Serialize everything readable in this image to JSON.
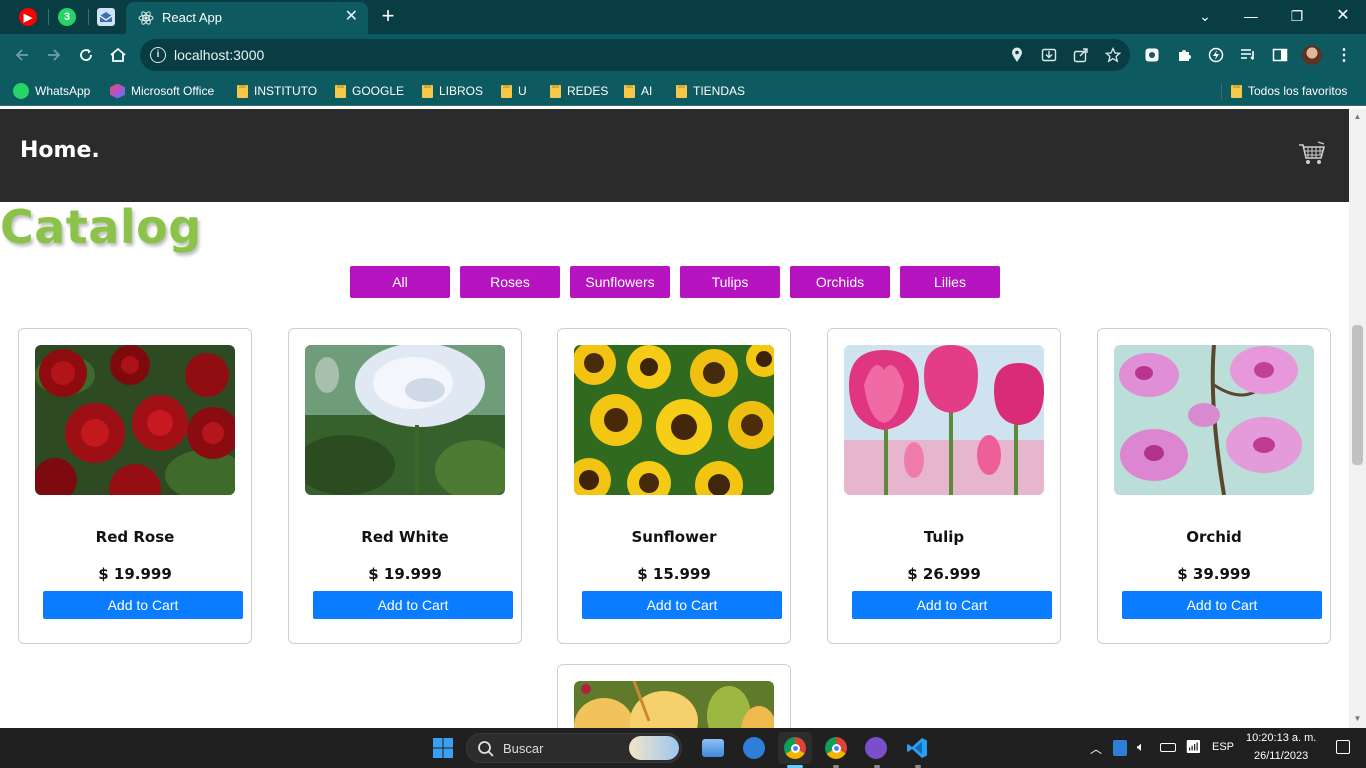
{
  "browser": {
    "tab_title": "React App",
    "url": "localhost:3000",
    "bookmarks": [
      "WhatsApp",
      "Microsoft Office",
      "INSTITUTO",
      "GOOGLE",
      "LIBROS",
      "U",
      "REDES",
      "AI",
      "TIENDAS"
    ],
    "all_favorites": "Todos los favoritos",
    "whatsapp_badge": "3"
  },
  "header": {
    "brand": "Home."
  },
  "catalog": {
    "title": "Catalog",
    "filters": [
      "All",
      "Roses",
      "Sunflowers",
      "Tulips",
      "Orchids",
      "Lilies"
    ],
    "add_label": "Add to Cart",
    "products": [
      {
        "name": "Red Rose",
        "price": "$ 19.999"
      },
      {
        "name": "Red White",
        "price": "$ 19.999"
      },
      {
        "name": "Sunflower",
        "price": "$ 15.999"
      },
      {
        "name": "Tulip",
        "price": "$ 26.999"
      },
      {
        "name": "Orchid",
        "price": "$ 39.999"
      }
    ]
  },
  "taskbar": {
    "search_placeholder": "Buscar",
    "language": "ESP",
    "time": "10:20:13 a. m.",
    "date": "26/11/2023"
  },
  "colors": {
    "chrome_dark": "#073d43",
    "chrome": "#0e5a61",
    "catalog_green": "#8bc34a",
    "filter_purple": "#b514c0",
    "button_blue": "#0a7cff",
    "header_dark": "#2b2b2b"
  }
}
